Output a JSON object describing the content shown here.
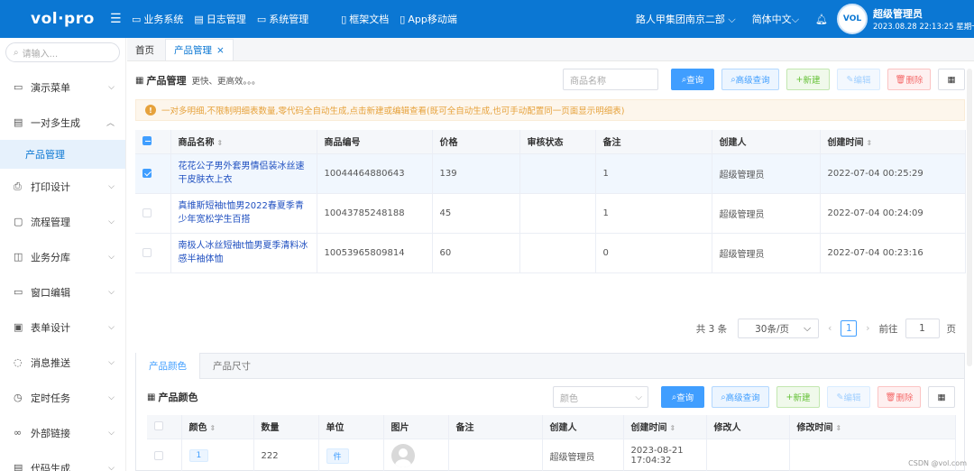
{
  "topbar": {
    "logo": "vol·pro",
    "nav": [
      {
        "icon": "monitor-icon",
        "label": "业务系统"
      },
      {
        "icon": "calendar-icon",
        "label": "日志管理"
      },
      {
        "icon": "monitor-icon",
        "label": "系统管理"
      },
      {
        "icon": "document-icon",
        "label": "框架文档"
      },
      {
        "icon": "phone-icon",
        "label": "App移动端"
      }
    ],
    "org": "路人甲集团南京二部",
    "lang": "简体中文",
    "user_name": "超级管理员",
    "user_time": "2023.08.28 22:13:25 星期一",
    "avatar_text": "VOL"
  },
  "sidebar": {
    "search_placeholder": "请输入...",
    "items": [
      {
        "label": "演示菜单"
      },
      {
        "label": "一对多生成"
      },
      {
        "label": "打印设计"
      },
      {
        "label": "流程管理"
      },
      {
        "label": "业务分库"
      },
      {
        "label": "窗口编辑"
      },
      {
        "label": "表单设计"
      },
      {
        "label": "消息推送"
      },
      {
        "label": "定时任务"
      },
      {
        "label": "外部链接"
      },
      {
        "label": "代码生成"
      }
    ],
    "sub_item": "产品管理"
  },
  "tabs": [
    {
      "label": "首页"
    },
    {
      "label": "产品管理"
    }
  ],
  "main": {
    "title": "产品管理",
    "subtitle": "更快、更高效。。。",
    "search_placeholder": "商品名称",
    "buttons": {
      "query": "查询",
      "advanced": "高级查询",
      "add": "新建",
      "edit": "编辑",
      "delete": "删除"
    },
    "alert": "一对多明细,不限制明细表数量,零代码全自动生成,点击新建或编辑查看(既可全自动生成,也可手动配置同一页面显示明细表)",
    "columns": [
      "商品名称",
      "商品编号",
      "价格",
      "审核状态",
      "备注",
      "创建人",
      "创建时间"
    ],
    "rows": [
      {
        "name": "花花公子男外套男情侣装冰丝速干皮肤衣上衣",
        "code": "10044464880643",
        "price": "139",
        "status": "",
        "note": "1",
        "creator": "超级管理员",
        "time": "2022-07-04 00:25:29"
      },
      {
        "name": "真维斯短袖t恤男2022春夏季青少年宽松学生百搭",
        "code": "10043785248188",
        "price": "45",
        "status": "",
        "note": "1",
        "creator": "超级管理员",
        "time": "2022-07-04 00:24:09"
      },
      {
        "name": "南极人冰丝短袖t恤男夏季清料冰感半袖体恤",
        "code": "10053965809814",
        "price": "60",
        "status": "",
        "note": "0",
        "creator": "超级管理员",
        "time": "2022-07-04 00:23:16"
      }
    ],
    "pager": {
      "total": "共 3 条",
      "size": "30条/页",
      "page": "1",
      "goto_prefix": "前往",
      "goto_value": "1",
      "goto_suffix": "页"
    }
  },
  "detail": {
    "tabs": [
      {
        "label": "产品颜色"
      },
      {
        "label": "产品尺寸"
      }
    ],
    "title": "产品颜色",
    "select_placeholder": "颜色",
    "columns": [
      "颜色",
      "数量",
      "单位",
      "图片",
      "备注",
      "创建人",
      "创建时间",
      "修改人",
      "修改时间"
    ],
    "row": {
      "color": "1",
      "qty": "222",
      "unit": "件",
      "note": "",
      "creator": "超级管理员",
      "time": "2023-08-21 17:04:32",
      "modifier": "",
      "mtime": ""
    }
  },
  "watermark": "CSDN @vol.com"
}
